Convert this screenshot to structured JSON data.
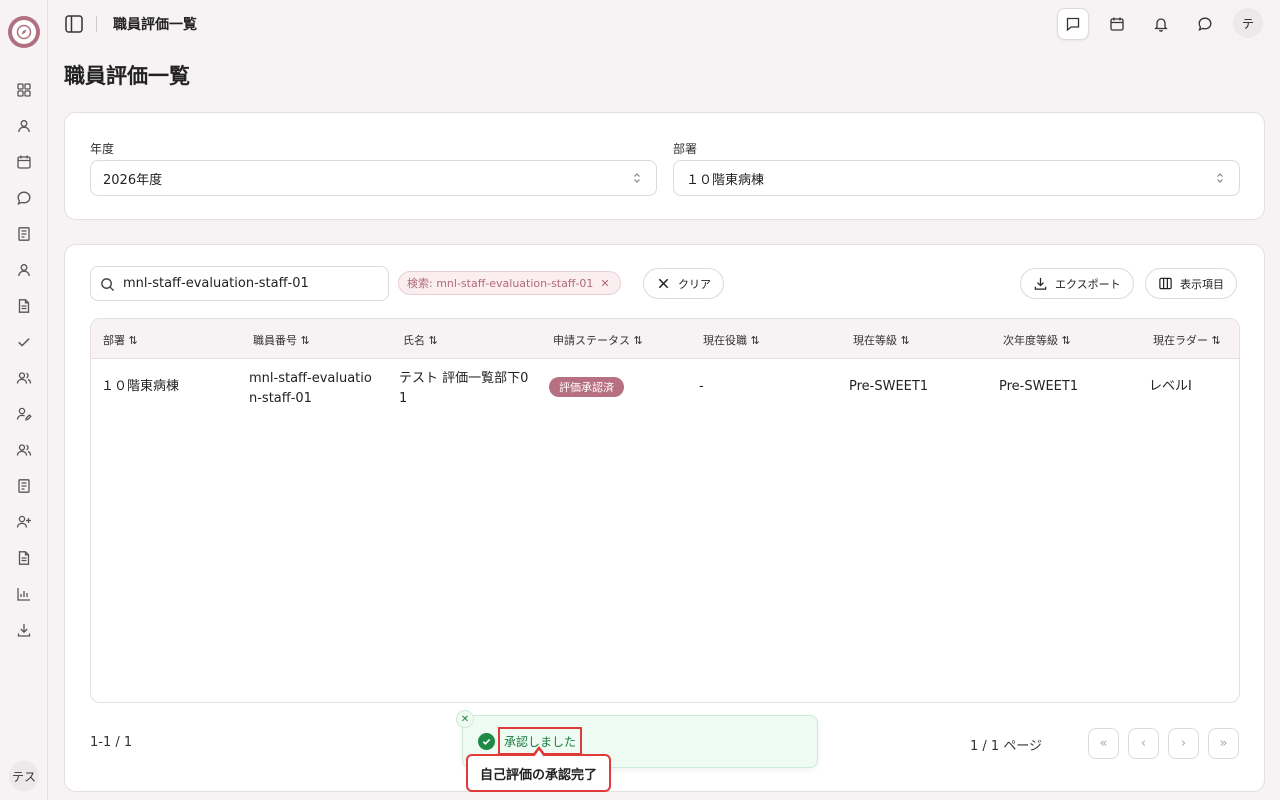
{
  "topbar": {
    "title": "職員評価一覧",
    "avatar": "テ"
  },
  "page": {
    "title": "職員評価一覧"
  },
  "sidebar": {
    "user_avatar": "テス"
  },
  "filters": {
    "year_label": "年度",
    "year_value": "2026年度",
    "dept_label": "部署",
    "dept_value": "１０階東病棟"
  },
  "search": {
    "value": "mnl-staff-evaluation-staff-01",
    "chip_label": "検索: mnl-staff-evaluation-staff-01",
    "clear_label": "クリア"
  },
  "toolbar": {
    "export_label": "エクスポート",
    "columns_label": "表示項目"
  },
  "table": {
    "columns": [
      "部署 ⇅",
      "職員番号 ⇅",
      "氏名 ⇅",
      "申請ステータス ⇅",
      "現在役職 ⇅",
      "現在等級 ⇅",
      "次年度等級 ⇅",
      "現在ラダー ⇅"
    ],
    "rows": [
      {
        "dept": "１０階東病棟",
        "staff_no_1": "mnl-staff-evaluatio",
        "staff_no_2": "n-staff-01",
        "name_1": "テスト 評価一覧部下0",
        "name_2": "1",
        "status": "評価承認済",
        "position": "-",
        "grade": "Pre-SWEET1",
        "next_grade": "Pre-SWEET1",
        "ladder": "レベルI"
      }
    ]
  },
  "footer": {
    "count": "1-1 / 1",
    "page_text": "1 / 1 ページ"
  },
  "toast": {
    "message": "承認しました",
    "callout": "自己評価の承認完了"
  },
  "colors": {
    "accent": "#b76f82",
    "success": "#1e8a45",
    "highlight": "#e03a3a"
  }
}
